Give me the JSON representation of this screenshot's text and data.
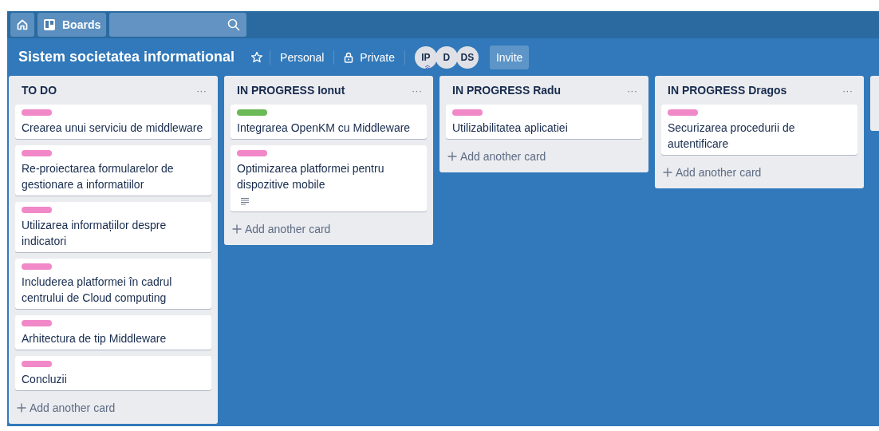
{
  "top_bar": {
    "boards_label": "Boards"
  },
  "board": {
    "title": "Sistem societatea informational",
    "starred": false,
    "team": "Personal",
    "visibility": "Private",
    "members": [
      {
        "initials": "IP",
        "admin": true
      },
      {
        "initials": "D",
        "admin": false
      },
      {
        "initials": "DS",
        "admin": false
      }
    ],
    "invite_label": "Invite"
  },
  "lists": [
    {
      "title": "TO DO",
      "menu": "···",
      "add_label": "Add another card",
      "cards": [
        {
          "title": "Crearea unui serviciu de middleware",
          "color": "#f188c8",
          "has_description": false
        },
        {
          "title": "Re-proiectarea formularelor de gestionare a informatiilor",
          "color": "#f188c8",
          "has_description": false
        },
        {
          "title": "Utilizarea informațiilor despre indicatori",
          "color": "#f188c8",
          "has_description": false
        },
        {
          "title": "Includerea platformei în cadrul centrului de Cloud computing",
          "color": "#f188c8",
          "has_description": false
        },
        {
          "title": "Arhitectura de tip Middleware",
          "color": "#f188c8",
          "has_description": false
        },
        {
          "title": "Concluzii",
          "color": "#f188c8",
          "has_description": false
        }
      ]
    },
    {
      "title": "IN PROGRESS Ionut",
      "menu": "···",
      "add_label": "Add another card",
      "cards": [
        {
          "title": "Integrarea OpenKM cu Middleware",
          "color": "#6cba57",
          "has_description": false
        },
        {
          "title": "Optimizarea platformei pentru dispozitive mobile",
          "color": "#f188c8",
          "has_description": true
        }
      ]
    },
    {
      "title": "IN PROGRESS Radu",
      "menu": "···",
      "add_label": "Add another card",
      "cards": [
        {
          "title": "Utilizabilitatea aplicatiei",
          "color": "#f188c8",
          "has_description": false
        }
      ]
    },
    {
      "title": "IN PROGRESS Dragos",
      "menu": "···",
      "add_label": "Add another card",
      "cards": [
        {
          "title": "Securizarea procedurii de autentificare",
          "color": "#f188c8",
          "has_description": false
        }
      ]
    }
  ]
}
